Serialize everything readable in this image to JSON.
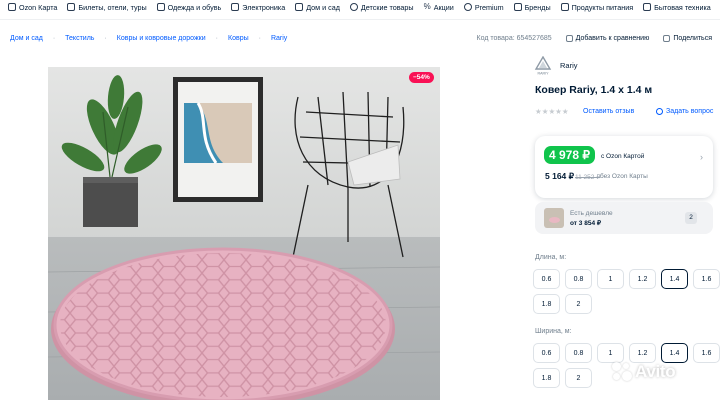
{
  "topnav": {
    "items": [
      {
        "label": "Ozon Карта",
        "icon": "card-icon"
      },
      {
        "label": "Билеты, отели, туры",
        "icon": "ticket-icon"
      },
      {
        "label": "Одежда и обувь",
        "icon": "shirt-icon"
      },
      {
        "label": "Электроника",
        "icon": "phone-icon"
      },
      {
        "label": "Дом и сад",
        "icon": "house-icon"
      },
      {
        "label": "Детские товары",
        "icon": "toy-icon"
      },
      {
        "label": "Акции",
        "icon": "percent-icon"
      },
      {
        "label": "Premium",
        "icon": "premium-icon"
      },
      {
        "label": "Бренды",
        "icon": "brand-icon"
      },
      {
        "label": "Продукты питания",
        "icon": "food-icon"
      },
      {
        "label": "Бытовая техника",
        "icon": "appliance-icon"
      }
    ]
  },
  "breadcrumbs": [
    "Дом и сад",
    "Текстиль",
    "Ковры и ковровые дорожки",
    "Ковры",
    "Rariy"
  ],
  "meta": {
    "product_code": "Код товара: 654527685",
    "compare": "Добавить к сравнению",
    "share": "Поделиться"
  },
  "product": {
    "discount_badge": "−54%",
    "brand": "Rariy",
    "brand_logo_text": "RARIY",
    "title": "Ковер Rariy, 1.4 x 1.4 м",
    "stars": "★★★★★",
    "reviews": "Оставить отзыв",
    "ask": "Задать вопрос"
  },
  "price": {
    "card_price": "4 978 ₽",
    "card_note": "с Ozon Картой",
    "regular_price": "5 164 ₽",
    "old_price": "11 252 ₽",
    "regular_note": "без Ozon Карты"
  },
  "cheaper": {
    "line1": "Есть дешевле",
    "line2": "от 3 854 ₽",
    "count": "2"
  },
  "options": {
    "length_label": "Длина, м:",
    "length_values": [
      "0.6",
      "0.8",
      "1",
      "1.2",
      "1.4",
      "1.6",
      "1.8",
      "2"
    ],
    "length_selected": "1.4",
    "width_label": "Ширина, м:",
    "width_values": [
      "0.6",
      "0.8",
      "1",
      "1.2",
      "1.4",
      "1.6",
      "1.8",
      "2"
    ],
    "width_selected": "1.4"
  },
  "watermark": "Avito",
  "colors": {
    "accent": "#005bff",
    "price_green": "#10c44c",
    "discount_red": "#f91155",
    "rug_pink": "#e7b2c2"
  }
}
